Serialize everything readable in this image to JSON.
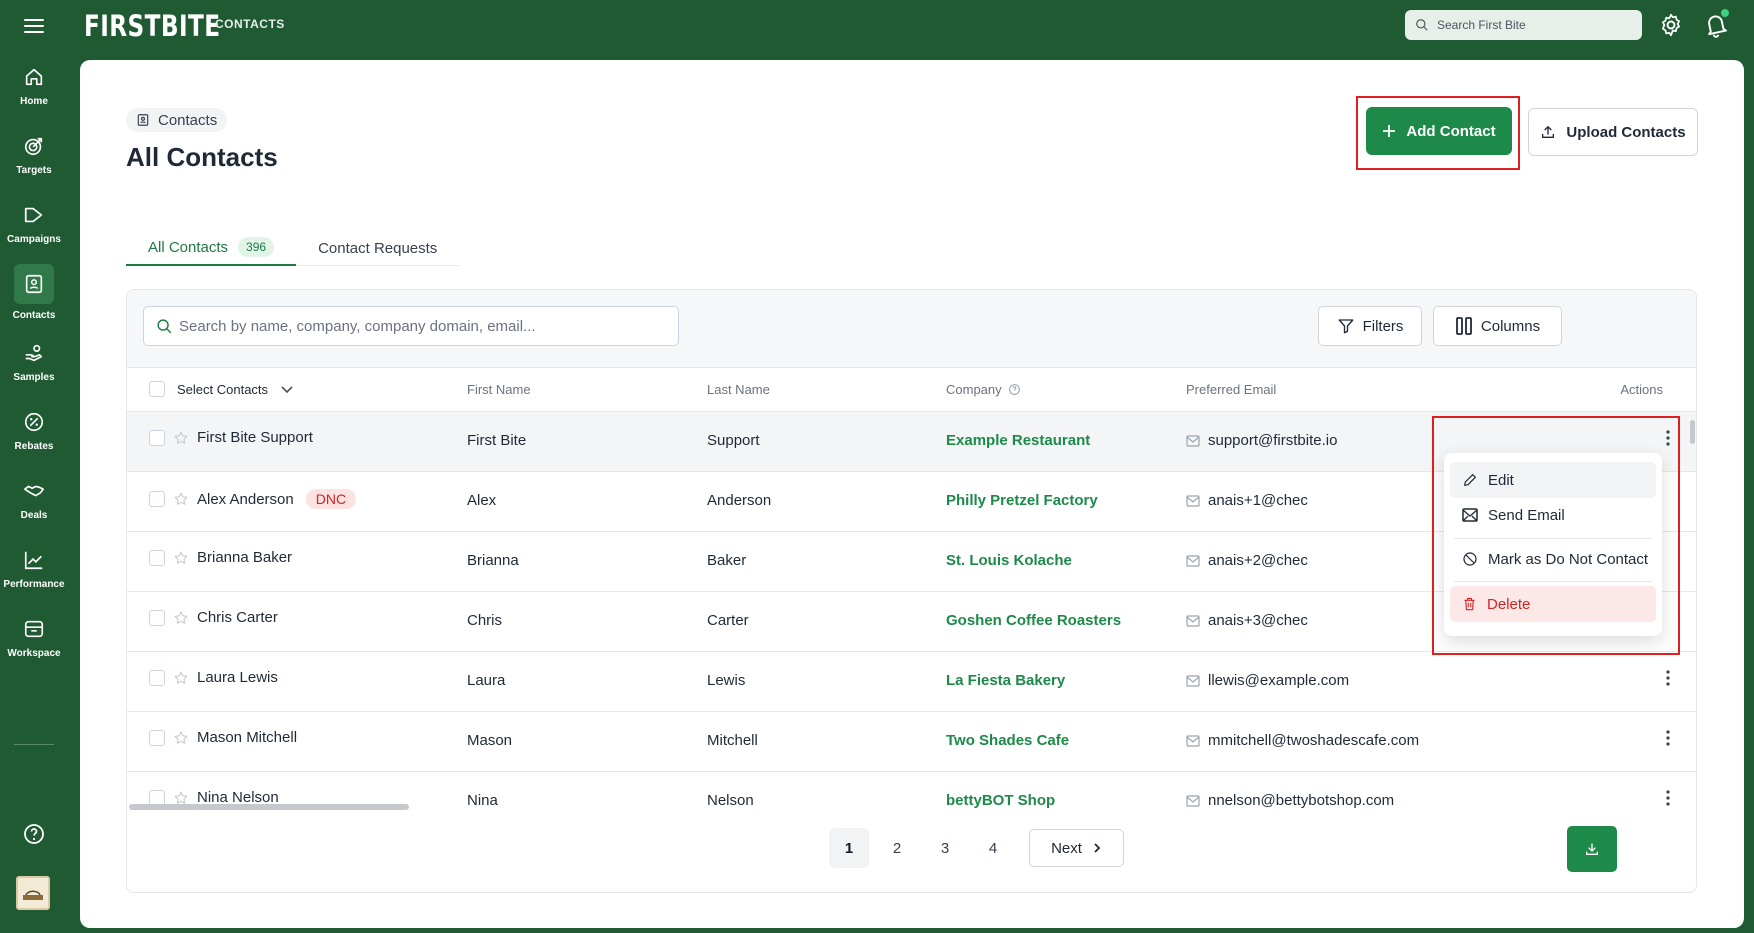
{
  "app": {
    "logo": "FIRSTBITE",
    "section": "CONTACTS",
    "search_placeholder": "Search First Bite"
  },
  "sidebar": {
    "items": [
      {
        "label": "Home",
        "icon": "home-icon"
      },
      {
        "label": "Targets",
        "icon": "target-icon"
      },
      {
        "label": "Campaigns",
        "icon": "megaphone-icon"
      },
      {
        "label": "Contacts",
        "icon": "contact-card-icon",
        "active": true
      },
      {
        "label": "Samples",
        "icon": "hand-sample-icon"
      },
      {
        "label": "Rebates",
        "icon": "percent-badge-icon"
      },
      {
        "label": "Deals",
        "icon": "handshake-icon"
      },
      {
        "label": "Performance",
        "icon": "trend-chart-icon"
      },
      {
        "label": "Workspace",
        "icon": "inbox-icon"
      }
    ]
  },
  "page": {
    "breadcrumb": "Contacts",
    "title": "All Contacts",
    "add_button": "Add Contact",
    "upload_button": "Upload Contacts",
    "tabs": [
      {
        "label": "All Contacts",
        "count": "396",
        "active": true
      },
      {
        "label": "Contact Requests"
      }
    ]
  },
  "table": {
    "search_placeholder": "Search by name, company, company domain, email...",
    "filters_label": "Filters",
    "columns_label": "Columns",
    "headers": {
      "select": "Select Contacts",
      "first_name": "First Name",
      "last_name": "Last Name",
      "company": "Company",
      "email": "Preferred Email",
      "actions": "Actions"
    },
    "rows": [
      {
        "name": "First Bite Support",
        "first": "First Bite",
        "last": "Support",
        "company": "Example Restaurant",
        "email": "support@firstbite.io",
        "email_visible": "support@firstbite.io"
      },
      {
        "name": "Alex Anderson",
        "badge": "DNC",
        "first": "Alex",
        "last": "Anderson",
        "company": "Philly Pretzel Factory",
        "email_visible": "anais+1@chec"
      },
      {
        "name": "Brianna Baker",
        "first": "Brianna",
        "last": "Baker",
        "company": "St. Louis Kolache",
        "email_visible": "anais+2@chec"
      },
      {
        "name": "Chris Carter",
        "first": "Chris",
        "last": "Carter",
        "company": "Goshen Coffee Roasters",
        "email_visible": "anais+3@chec"
      },
      {
        "name": "Laura Lewis",
        "first": "Laura",
        "last": "Lewis",
        "company": "La Fiesta Bakery",
        "email_visible": "llewis@example.com"
      },
      {
        "name": "Mason Mitchell",
        "first": "Mason",
        "last": "Mitchell",
        "company": "Two Shades Cafe",
        "email_visible": "mmitchell@twoshadescafe.com"
      },
      {
        "name": "Nina Nelson",
        "first": "Nina",
        "last": "Nelson",
        "company": "bettyBOT Shop",
        "email_visible": "nnelson@bettybotshop.com"
      }
    ]
  },
  "pagination": {
    "pages": [
      "1",
      "2",
      "3",
      "4"
    ],
    "current": "1",
    "next_label": "Next"
  },
  "menu": {
    "edit": "Edit",
    "send_email": "Send Email",
    "mark_dnc": "Mark as Do Not Contact",
    "delete": "Delete"
  },
  "colors": {
    "brand": "#1f5a33",
    "accent": "#1e8a4a",
    "danger": "#d32222",
    "highlight": "#e02020"
  }
}
